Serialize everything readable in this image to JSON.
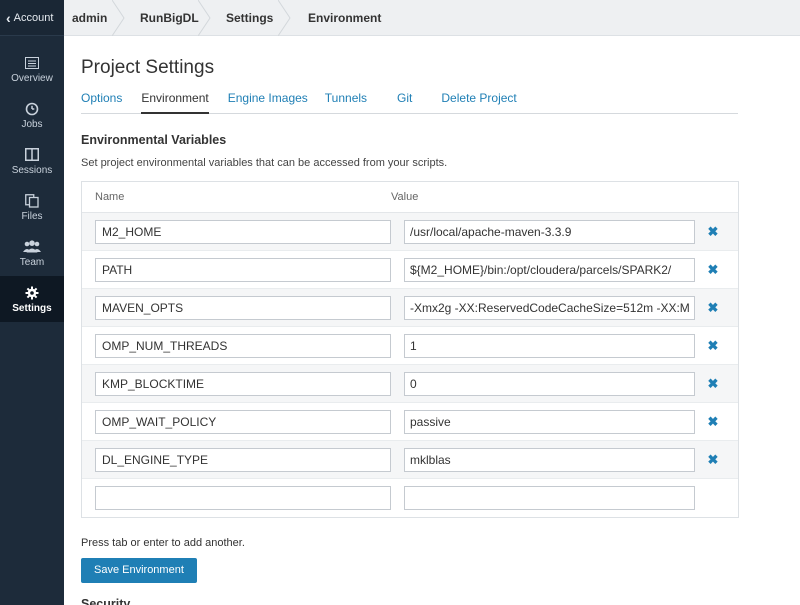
{
  "sidebar": {
    "back_label": "Account",
    "items": [
      {
        "label": "Overview",
        "icon": "overview-icon"
      },
      {
        "label": "Jobs",
        "icon": "clock-icon"
      },
      {
        "label": "Sessions",
        "icon": "sessions-icon"
      },
      {
        "label": "Files",
        "icon": "files-icon"
      },
      {
        "label": "Team",
        "icon": "team-icon"
      },
      {
        "label": "Settings",
        "icon": "gear-icon"
      }
    ],
    "active": "Settings"
  },
  "breadcrumb": [
    "admin",
    "RunBigDL",
    "Settings",
    "Environment"
  ],
  "page": {
    "title": "Project Settings",
    "tabs": [
      {
        "label": "Options"
      },
      {
        "label": "Environment"
      },
      {
        "label": "Engine Images"
      },
      {
        "label": "Tunnels"
      },
      {
        "label": "Git"
      },
      {
        "label": "Delete Project"
      }
    ],
    "active_tab": "Environment"
  },
  "env": {
    "section_title": "Environmental Variables",
    "description": "Set project environmental variables that can be accessed from your scripts.",
    "col_name": "Name",
    "col_value": "Value",
    "rows": [
      {
        "name": "M2_HOME",
        "value": "/usr/local/apache-maven-3.3.9"
      },
      {
        "name": "PATH",
        "value": "${M2_HOME}/bin:/opt/cloudera/parcels/SPARK2/"
      },
      {
        "name": "MAVEN_OPTS",
        "value": "-Xmx2g -XX:ReservedCodeCacheSize=512m -XX:M"
      },
      {
        "name": "OMP_NUM_THREADS",
        "value": "1"
      },
      {
        "name": "KMP_BLOCKTIME",
        "value": "0"
      },
      {
        "name": "OMP_WAIT_POLICY",
        "value": "passive"
      },
      {
        "name": "DL_ENGINE_TYPE",
        "value": "mklblas"
      },
      {
        "name": "",
        "value": ""
      }
    ],
    "delete_glyph": "✖",
    "hint": "Press tab or enter to add another.",
    "save_label": "Save Environment"
  },
  "next_section_title": "Security",
  "colors": {
    "sidebar_bg": "#1d2b3a",
    "accent": "#1f7fb5"
  }
}
